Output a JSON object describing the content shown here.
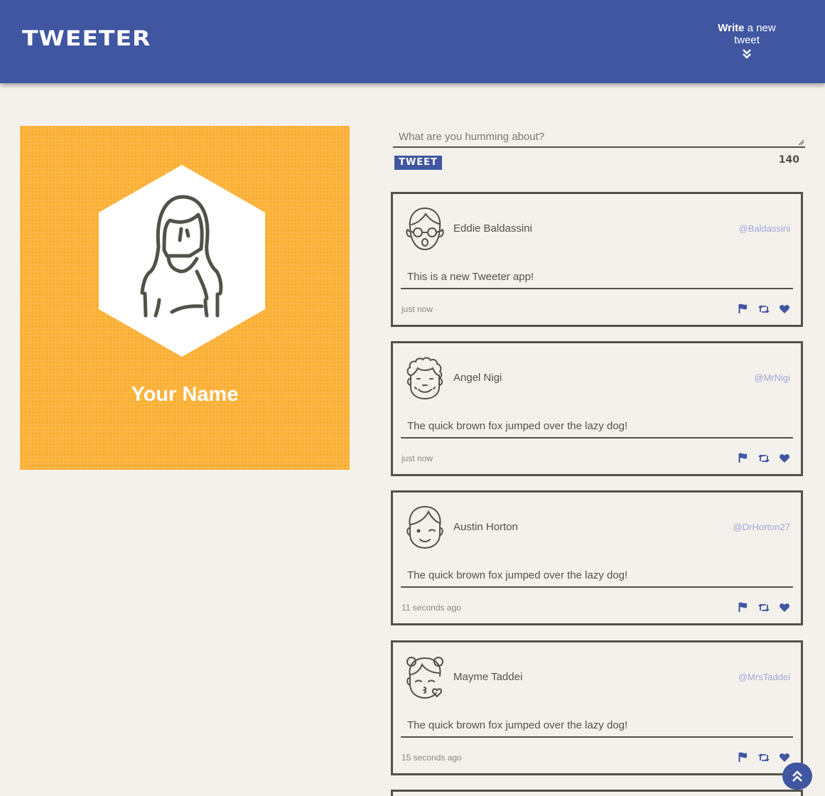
{
  "nav": {
    "brand": "TWEETER",
    "write_bold": "Write",
    "write_rest": " a new tweet",
    "write_icon": "angle-double-down-icon"
  },
  "profile": {
    "name": "Your Name",
    "avatar_icon": "woman-avatar-icon",
    "background_color": "#fbaf33"
  },
  "compose": {
    "placeholder": "What are you humming about?",
    "value": "",
    "submit_label": "TWEET",
    "counter": "140"
  },
  "tweets": [
    {
      "name": "Eddie Baldassini",
      "handle": "@Baldassini",
      "content": "This is a new Tweeter app!",
      "time": "just now",
      "avatar_icon": "glasses-face-avatar-icon"
    },
    {
      "name": "Angel Nigi",
      "handle": "@MrNigi",
      "content": "The quick brown fox jumped over the lazy dog!",
      "time": "just now",
      "avatar_icon": "curly-hair-avatar-icon"
    },
    {
      "name": "Austin Horton",
      "handle": "@DrHorton27",
      "content": "The quick brown fox jumped over the lazy dog!",
      "time": "11 seconds ago",
      "avatar_icon": "winking-face-avatar-icon"
    },
    {
      "name": "Mayme Taddei",
      "handle": "@MrsTaddei",
      "content": "The quick brown fox jumped over the lazy dog!",
      "time": "15 seconds ago",
      "avatar_icon": "kissing-girl-avatar-icon"
    }
  ],
  "actions": {
    "flag_icon": "flag-icon",
    "retweet_icon": "retweet-icon",
    "like_icon": "heart-icon"
  },
  "scroll_top_icon": "angle-double-up-icon",
  "colors": {
    "accent": "#4056a1",
    "background": "#f4f1ec",
    "text": "#545149",
    "handle": "#9fa7d6"
  }
}
